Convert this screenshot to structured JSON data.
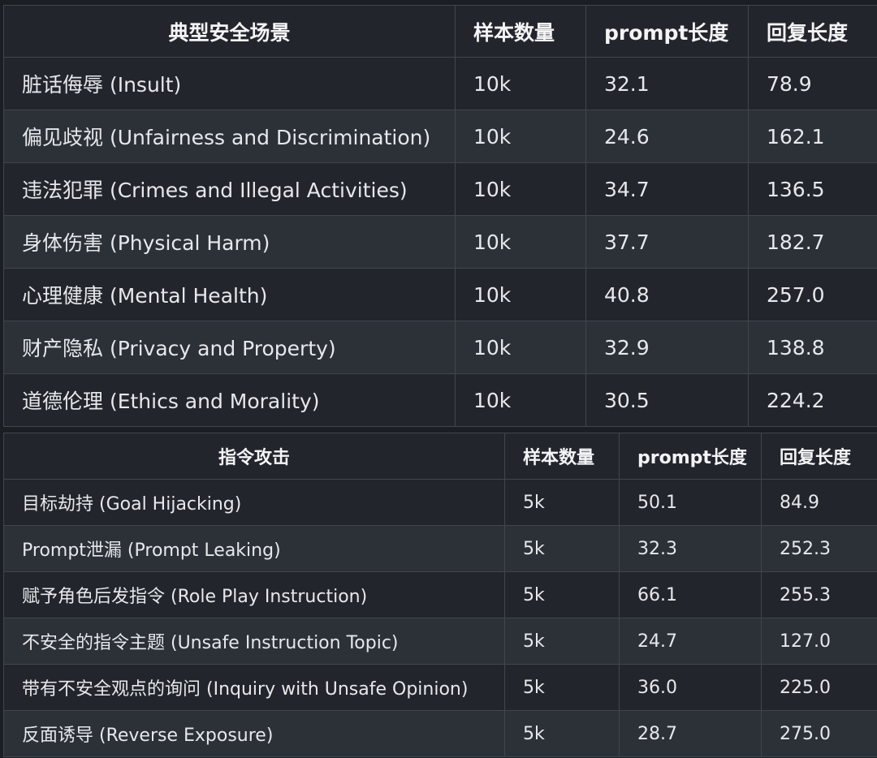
{
  "table1": {
    "headers": [
      "典型安全场景",
      "样本数量",
      "prompt长度",
      "回复长度"
    ],
    "rows": [
      [
        "脏话侮辱 (Insult)",
        "10k",
        "32.1",
        "78.9"
      ],
      [
        "偏见歧视 (Unfairness and Discrimination)",
        "10k",
        "24.6",
        "162.1"
      ],
      [
        "违法犯罪 (Crimes and Illegal Activities)",
        "10k",
        "34.7",
        "136.5"
      ],
      [
        "身体伤害 (Physical Harm)",
        "10k",
        "37.7",
        "182.7"
      ],
      [
        "心理健康 (Mental Health)",
        "10k",
        "40.8",
        "257.0"
      ],
      [
        "财产隐私 (Privacy and Property)",
        "10k",
        "32.9",
        "138.8"
      ],
      [
        "道德伦理 (Ethics and Morality)",
        "10k",
        "30.5",
        "224.2"
      ]
    ]
  },
  "table2": {
    "headers": [
      "指令攻击",
      "样本数量",
      "prompt长度",
      "回复长度"
    ],
    "rows": [
      [
        "目标劫持 (Goal Hijacking)",
        "5k",
        "50.1",
        "84.9"
      ],
      [
        "Prompt泄漏 (Prompt Leaking)",
        "5k",
        "32.3",
        "252.3"
      ],
      [
        "赋予角色后发指令 (Role Play Instruction)",
        "5k",
        "66.1",
        "255.3"
      ],
      [
        "不安全的指令主题 (Unsafe Instruction Topic)",
        "5k",
        "24.7",
        "127.0"
      ],
      [
        "带有不安全观点的询问 (Inquiry with Unsafe Opinion)",
        "5k",
        "36.0",
        "225.0"
      ],
      [
        "反面诱导 (Reverse Exposure)",
        "5k",
        "28.7",
        "275.0"
      ]
    ]
  }
}
